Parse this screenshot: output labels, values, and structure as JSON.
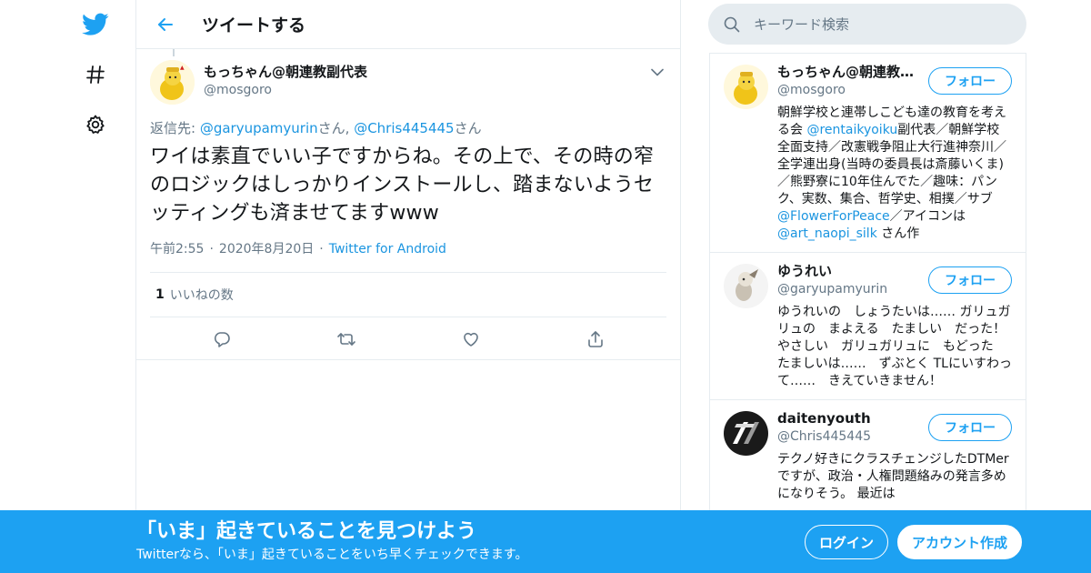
{
  "header": {
    "title": "ツイートする"
  },
  "tweet": {
    "display_name": "もっちゃん@朝連教副代表",
    "handle": "@mosgoro",
    "reply_prefix": "返信先: ",
    "reply_users": [
      "@garyupamyurin",
      "@Chris445445"
    ],
    "reply_suffix": "さん",
    "reply_sep": "さん, ",
    "text": "ワイは素直でいい子ですからね。その上で、その時の窄のロジックはしっかりインストールし、踏まないようセッティングも済ませてますwww",
    "time": "午前2:55",
    "date": "2020年8月20日",
    "source": "Twitter for Android",
    "likes_count": "1",
    "likes_label": "いいねの数"
  },
  "search": {
    "placeholder": "キーワード検索"
  },
  "sidebar": {
    "follow_label": "フォロー",
    "users": [
      {
        "name": "もっちゃん@朝連教…",
        "handle": "@mosgoro",
        "bio_parts": [
          "朝鮮学校と連帯しこども達の教育を考える会 ",
          "@rentaikyoiku",
          "副代表／朝鮮学校全面支持／改憲戦争阻止大行進神奈川／全学連出身(当時の委員長は斎藤いくま)／熊野寮に10年住んでた／趣味：パンク、実数、集合、哲学史、相撲／サブ",
          "@FlowerForPeace",
          "／アイコンは ",
          "@art_naopi_silk",
          " さん作"
        ]
      },
      {
        "name": "ゆうれい",
        "handle": "@garyupamyurin",
        "bio": "ゆうれいの　しょうたいは…… ガリュガリュの　まよえる　たましい　だった！ やさしい　ガリュガリュに　もどった　たましいは……　ずぶとく TLにいすわって……　きえていきません！"
      },
      {
        "name": "daitenyouth",
        "handle": "@Chris445445",
        "bio": "テクノ好きにクラスチェンジしたDTMerですが、政治・人権問題絡みの発言多めになりそう。 最近は"
      }
    ]
  },
  "banner": {
    "title": "「いま」起きていることを見つけよう",
    "subtitle": "Twitterなら、「いま」起きていることをいち早くチェックできます。",
    "login_label": "ログイン",
    "signup_label": "アカウント作成"
  },
  "colors": {
    "brand": "#1da1f2",
    "link": "#1b95e0",
    "muted": "#657786",
    "border": "#e6ecf0"
  }
}
